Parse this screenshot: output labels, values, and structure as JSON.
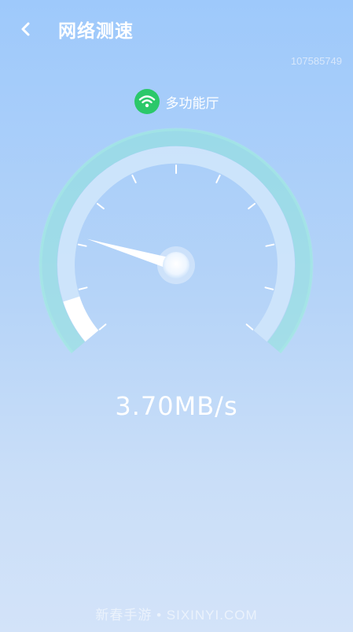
{
  "header": {
    "title": "网络测速"
  },
  "account_id": "107585749",
  "network": {
    "name": "多功能厅",
    "icon": "wifi-icon"
  },
  "speed": {
    "display": "3.70MB/s",
    "level_fraction": 0.04
  },
  "watermark": "新春手游 • SIXINYI.COM",
  "colors": {
    "wifi_badge": "#2bc86a",
    "gauge_glow": "#8fe3da",
    "gauge_track": "#cfe6fb",
    "gauge_fill": "#ffffff"
  }
}
